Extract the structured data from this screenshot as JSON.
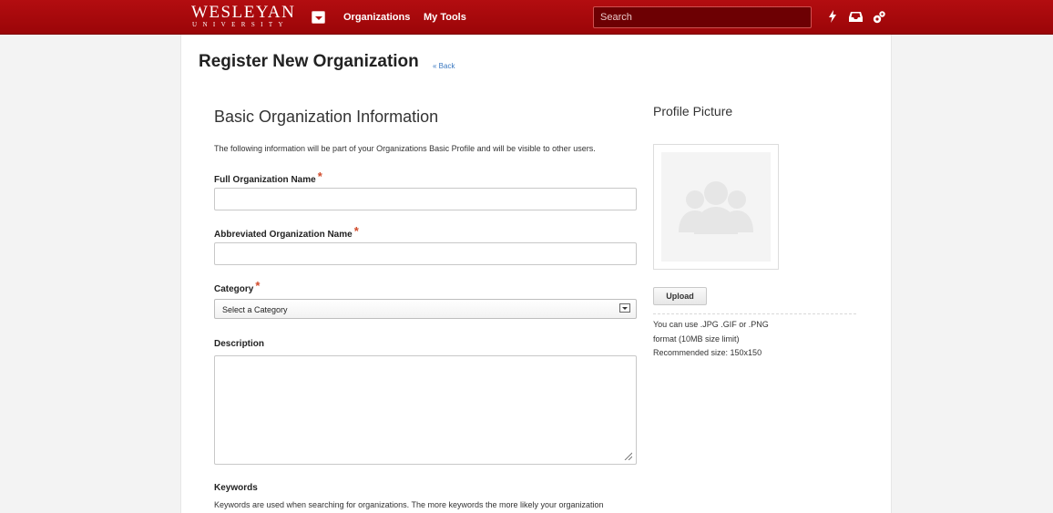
{
  "header": {
    "logo_main": "WESLEYAN",
    "logo_sub": "UNIVERSITY",
    "nav": [
      "Organizations",
      "My Tools"
    ],
    "search_placeholder": "Search",
    "icons": [
      "lightning-icon",
      "inbox-icon",
      "gears-icon"
    ],
    "brand_color": "#a80a0d"
  },
  "page": {
    "title": "Register New Organization",
    "back_link": "« Back"
  },
  "form": {
    "section_title": "Basic Organization Information",
    "intro": "The following information will be part of your Organizations Basic Profile and will be visible to other users.",
    "required_mark": "*",
    "full_name_label": "Full Organization Name",
    "full_name_value": "",
    "abbrev_name_label": "Abbreviated Organization Name",
    "abbrev_name_value": "",
    "category_label": "Category",
    "category_selected": "Select a Category",
    "description_label": "Description",
    "description_value": "",
    "keywords_label": "Keywords",
    "keywords_help": "Keywords are used when searching for organizations. The more keywords the more likely your organization"
  },
  "profile_picture": {
    "title": "Profile Picture",
    "upload_label": "Upload",
    "help_lines": [
      "You can use .JPG .GIF or .PNG",
      "format (10MB size limit)",
      "Recommended size: 150x150"
    ]
  }
}
